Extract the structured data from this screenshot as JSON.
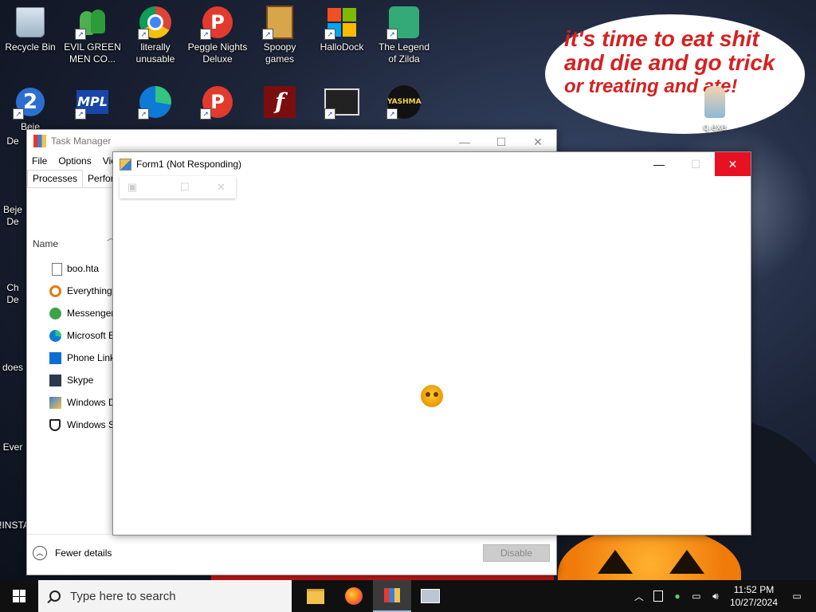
{
  "desktop": {
    "icons_row1": [
      {
        "label": "Recycle Bin",
        "icon": "recycle-bin-icon"
      },
      {
        "label": "EVIL GREEN MEN CO...",
        "icon": "messenger-icon"
      },
      {
        "label": "literally unusable",
        "icon": "chrome-icon"
      },
      {
        "label": "Peggle Nights Deluxe",
        "icon": "peggle-icon"
      },
      {
        "label": "Spoopy games",
        "icon": "folder-icon"
      },
      {
        "label": "HalloDock",
        "icon": "windows-shield-icon"
      },
      {
        "label": "The Legend of Zilda",
        "icon": "zilda-icon"
      }
    ],
    "icons_row2": [
      {
        "label": "Beje",
        "icon": "bejeweled-icon"
      },
      {
        "label": "",
        "icon": "mpl-icon"
      },
      {
        "label": "",
        "icon": "edge-icon"
      },
      {
        "label": "",
        "icon": "peggle-icon"
      },
      {
        "label": "",
        "icon": "flash-icon"
      },
      {
        "label": "",
        "icon": "rdp-icon"
      },
      {
        "label": "",
        "icon": "yashma-icon"
      }
    ],
    "left_partial_labels": [
      "De",
      "Beje",
      "De",
      "Ch",
      "De",
      "does",
      "Ever",
      "!INSTA"
    ],
    "yashma_text": "YASHMA",
    "bejeweled_glyph": "2",
    "mpl_text": "MPL",
    "peggle_glyph": "P",
    "flash_glyph": "f",
    "bubble": {
      "line1": "it's time to eat shit",
      "line2": "and die and go trick",
      "line3": "or treating and ate!"
    },
    "qexe_label": "q.exe"
  },
  "task_manager": {
    "title": "Task Manager",
    "menu": [
      "File",
      "Options",
      "Vie"
    ],
    "tabs": [
      "Processes",
      "Perfor"
    ],
    "column_name": "Name",
    "processes": [
      {
        "name": "boo.hta",
        "icon": "file-icon"
      },
      {
        "name": "Everything",
        "icon": "search-magnifier-icon"
      },
      {
        "name": "Messenger",
        "icon": "messenger-icon"
      },
      {
        "name": "Microsoft E",
        "icon": "edge-icon"
      },
      {
        "name": "Phone Link",
        "icon": "phone-link-icon"
      },
      {
        "name": "Skype",
        "icon": "skype-icon"
      },
      {
        "name": "Windows D",
        "icon": "windows-defender-icon"
      },
      {
        "name": "Windows S",
        "icon": "shield-icon"
      }
    ],
    "fewer_details": "Fewer details",
    "disable_button": "Disable"
  },
  "form1": {
    "title": "Form1 (Not Responding)",
    "minimize_glyph": "—",
    "maximize_glyph": "☐",
    "close_glyph": "✕"
  },
  "taskbar": {
    "search_placeholder": "Type here to search",
    "time": "11:52 PM",
    "date": "10/27/2024",
    "apps": [
      "file-explorer-icon",
      "firefox-icon",
      "task-manager-icon",
      "form1-app-icon"
    ]
  }
}
